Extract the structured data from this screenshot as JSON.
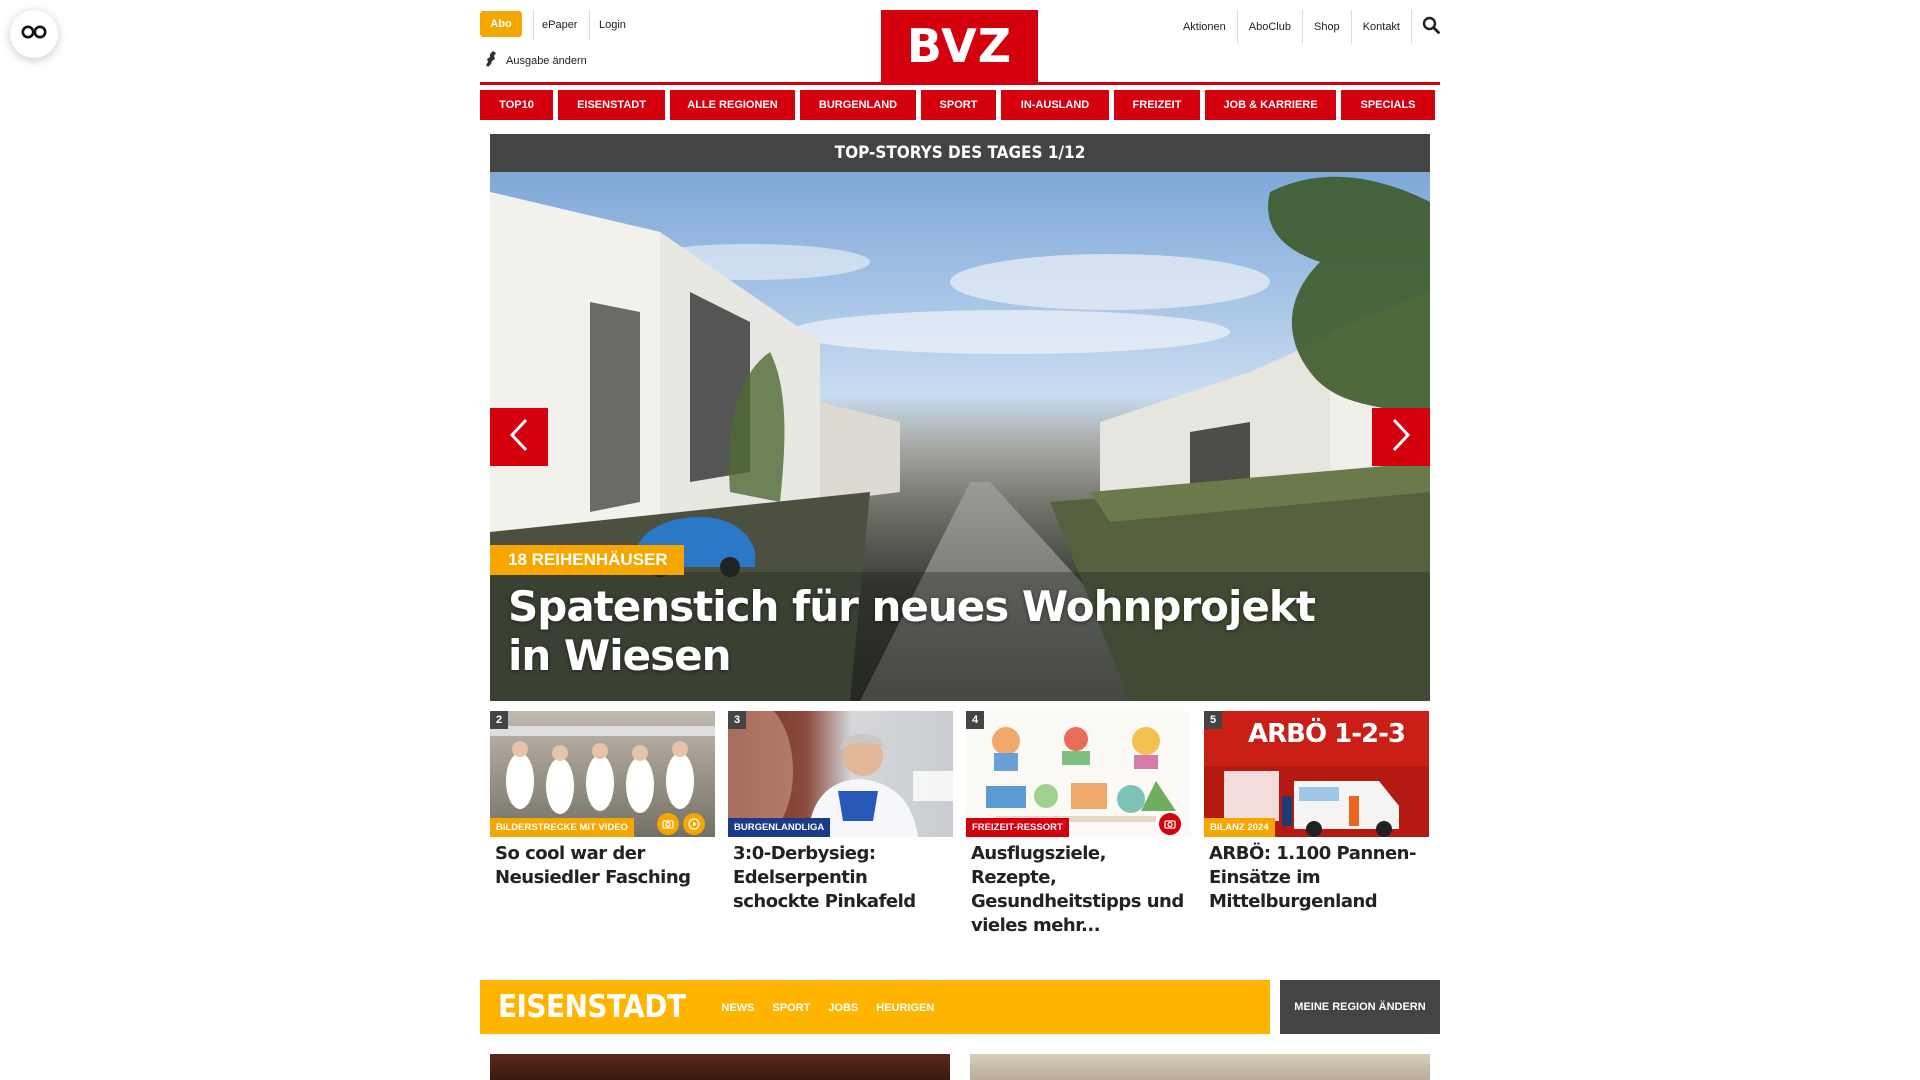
{
  "accessibility": {
    "icon": "glasses-icon"
  },
  "header": {
    "abo_label": "Abo",
    "epaper_label": "ePaper",
    "login_label": "Login",
    "ausgabe_label": "Ausgabe ändern",
    "logo_text": "BVZ",
    "right_links": [
      "Aktionen",
      "AboClub",
      "Shop",
      "Kontakt"
    ],
    "accent_color": "#d4000d",
    "abo_color": "#f5a700"
  },
  "nav": {
    "items": [
      "TOP10",
      "EISENSTADT",
      "ALLE REGIONEN",
      "BURGENLAND",
      "SPORT",
      "IN-AUSLAND",
      "FREIZEIT",
      "JOB & KARRIERE",
      "SPECIALS"
    ]
  },
  "slider": {
    "heading": "TOP-STORYS DES TAGES 1/12",
    "kicker": "18 REIHENHÄUSER",
    "headline": "Spatenstich für neues Wohnprojekt in Wiesen"
  },
  "cards": [
    {
      "num": "2",
      "tag": "BILDERSTRECKE MIT VIDEO",
      "tag_color": "#f5a700",
      "title": "So cool war der Neusiedler Fasching",
      "icons": [
        "camera-icon",
        "play-icon"
      ]
    },
    {
      "num": "3",
      "tag": "BURGENLANDLIGA",
      "tag_color": "#1a3a8a",
      "title": "3:0-Derbysieg: Edelserpentin schockte Pinkafeld",
      "icons": []
    },
    {
      "num": "4",
      "tag": "FREIZEIT-RESSORT",
      "tag_color": "#d4000d",
      "title": "Ausflugsziele, Rezepte, Gesundheitstipps und vieles mehr...",
      "icons": [
        "camera-icon"
      ]
    },
    {
      "num": "5",
      "tag": "BILANZ 2024",
      "tag_color": "#f5a700",
      "title": "ARBÖ: 1.100 Pannen-Einsätze im Mittelburgenland",
      "image_text": "ARBÖ 1-2-3",
      "icons": []
    }
  ],
  "region": {
    "title": "EISENSTADT",
    "links": [
      "NEWS",
      "SPORT",
      "JOBS",
      "HEURIGEN"
    ],
    "change_label": "MEINE REGION ÄNDERN",
    "color": "#ffb400"
  }
}
